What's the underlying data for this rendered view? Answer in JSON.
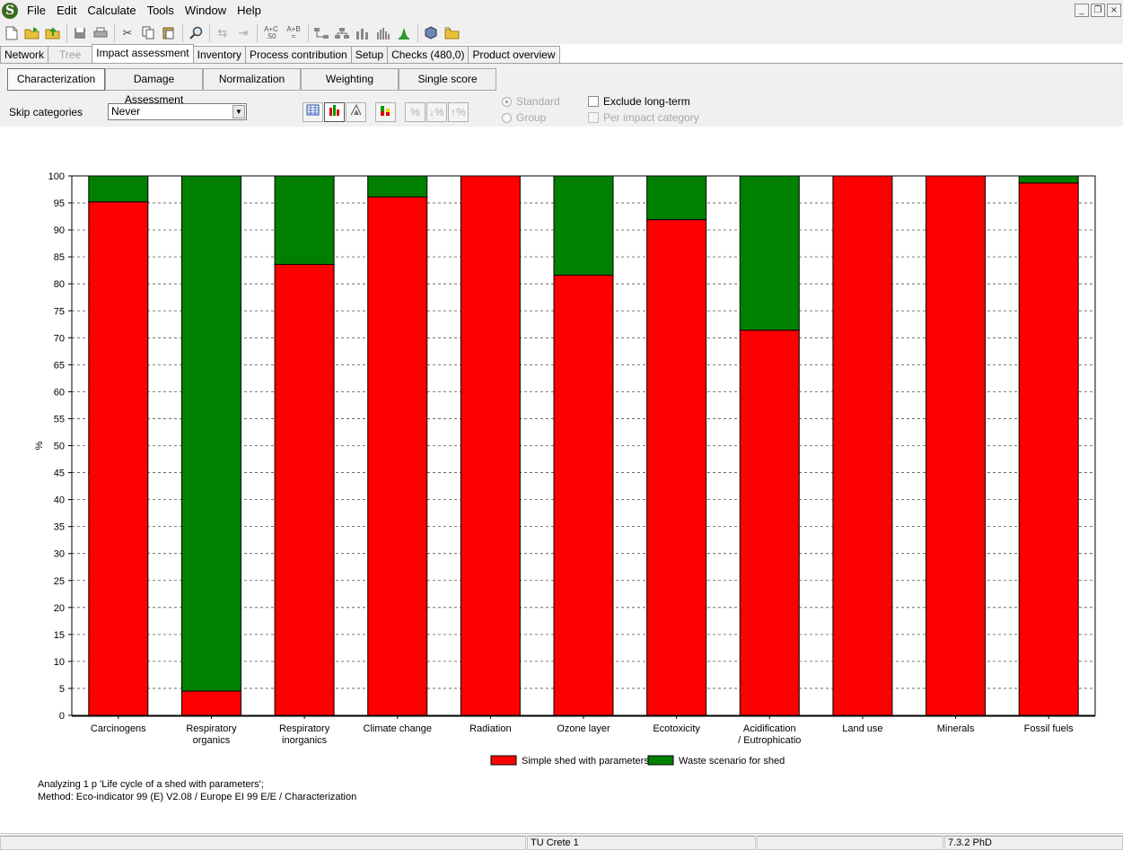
{
  "menu": {
    "items": [
      "File",
      "Edit",
      "Calculate",
      "Tools",
      "Window",
      "Help"
    ],
    "logo_letter": "S"
  },
  "window_controls": [
    "_",
    "❐",
    "×"
  ],
  "toolbar": {
    "formula_1": "A+C\n.50",
    "formula_2": "A+B\n="
  },
  "tabs": {
    "items": [
      {
        "label": "Network",
        "state": "normal"
      },
      {
        "label": "Tree",
        "state": "disabled"
      },
      {
        "label": "Impact assessment",
        "state": "active"
      },
      {
        "label": "Inventory",
        "state": "normal"
      },
      {
        "label": "Process contribution",
        "state": "normal"
      },
      {
        "label": "Setup",
        "state": "normal"
      },
      {
        "label": "Checks (480,0)",
        "state": "normal"
      },
      {
        "label": "Product overview",
        "state": "normal"
      }
    ]
  },
  "subtabs": {
    "items": [
      {
        "label": "Characterization",
        "state": "active"
      },
      {
        "label": "Damage Assessment",
        "state": "normal"
      },
      {
        "label": "Normalization",
        "state": "normal"
      },
      {
        "label": "Weighting",
        "state": "normal"
      },
      {
        "label": "Single score",
        "state": "normal"
      }
    ]
  },
  "controls": {
    "skip_label": "Skip categories",
    "skip_value": "Never",
    "radio_standard": "Standard",
    "radio_group": "Group",
    "exclude_long_term": "Exclude long-term",
    "per_impact_category": "Per impact category"
  },
  "chart_data": {
    "type": "bar",
    "stacked": true,
    "categories": [
      "Carcinogens",
      "Respiratory\norganics",
      "Respiratory\ninorganics",
      "Climate change",
      "Radiation",
      "Ozone layer",
      "Ecotoxicity",
      "Acidification\n/ Eutrophicatio",
      "Land use",
      "Minerals",
      "Fossil fuels"
    ],
    "series": [
      {
        "name": "Simple shed with parameters",
        "color": "#ff0000",
        "values": [
          95.2,
          4.5,
          83.6,
          96.1,
          100,
          81.6,
          91.9,
          71.4,
          100,
          100,
          98.7
        ]
      },
      {
        "name": "Waste scenario for shed",
        "color": "#008000",
        "values": [
          4.8,
          95.5,
          16.4,
          3.9,
          0,
          18.4,
          8.1,
          28.6,
          0,
          0,
          1.3
        ]
      }
    ],
    "ylabel": "%",
    "ylim": [
      0,
      100
    ],
    "yticks": [
      0,
      5,
      10,
      15,
      20,
      25,
      30,
      35,
      40,
      45,
      50,
      55,
      60,
      65,
      70,
      75,
      80,
      85,
      90,
      95,
      100
    ],
    "grid": true,
    "legend": "bottom-center"
  },
  "notes": {
    "line1": "Analyzing 1 p 'Life cycle of a shed with parameters';",
    "line2": "Method: Eco-indicator 99 (E) V2.08 / Europe EI 99 E/E / Characterization"
  },
  "status": {
    "user": "TU Crete 1",
    "version": "7.3.2 PhD"
  }
}
